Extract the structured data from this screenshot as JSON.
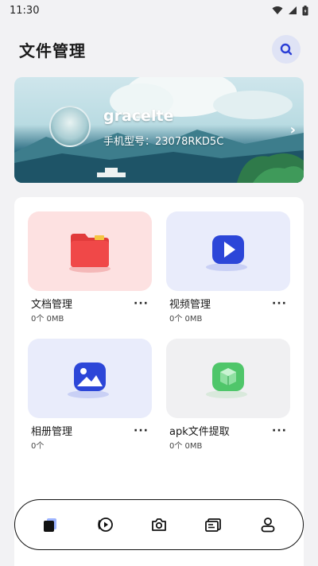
{
  "status_bar": {
    "time": "11:30"
  },
  "header": {
    "title": "文件管理",
    "search_icon": "search-icon"
  },
  "banner": {
    "name": "gracelte",
    "model": "手机型号：23078RKD5C",
    "arrow": "›"
  },
  "cards": [
    {
      "title": "文档管理",
      "meta": "0个  0MB",
      "more": "···",
      "icon": "folder-icon",
      "tile_color": "#fde1e1"
    },
    {
      "title": "视频管理",
      "meta": "0个  0MB",
      "more": "···",
      "icon": "play-icon",
      "tile_color": "#e9ecfb"
    },
    {
      "title": "相册管理",
      "meta": "0个",
      "more": "···",
      "icon": "image-icon",
      "tile_color": "#e9ecfb"
    },
    {
      "title": "apk文件提取",
      "meta": "0个  0MB",
      "more": "···",
      "icon": "package-icon",
      "tile_color": "#f0f0f2"
    }
  ],
  "tabbar": {
    "tabs": [
      {
        "icon": "document-tab-icon"
      },
      {
        "icon": "video-tab-icon"
      },
      {
        "icon": "camera-tab-icon"
      },
      {
        "icon": "message-tab-icon"
      },
      {
        "icon": "profile-tab-icon"
      }
    ]
  }
}
